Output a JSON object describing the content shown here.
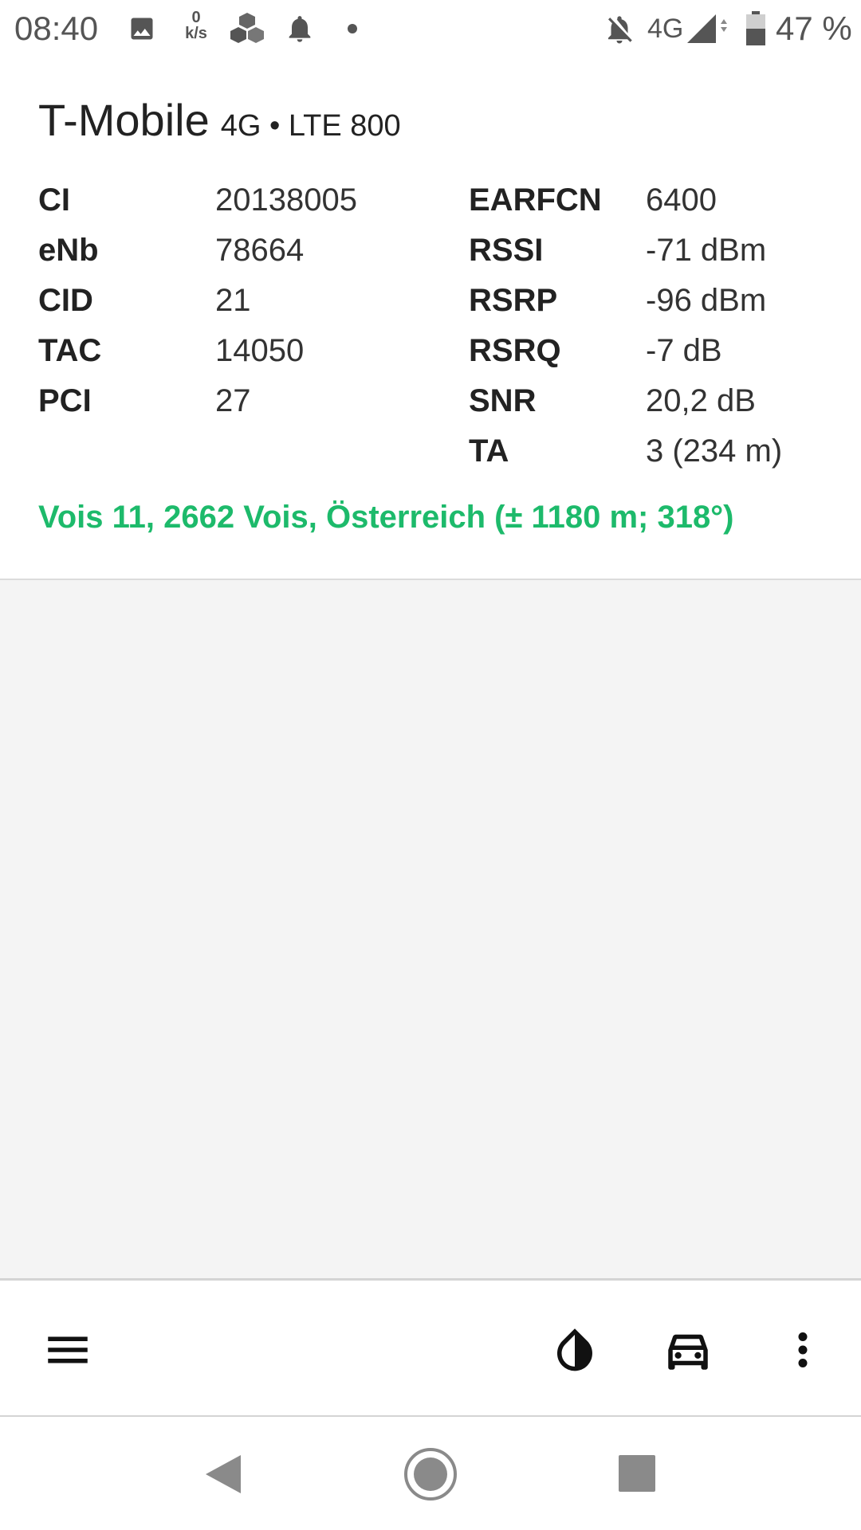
{
  "status_bar": {
    "time": "08:40",
    "net_speed_value": "0",
    "net_speed_unit": "k/s",
    "network_type": "4G",
    "battery": "47 %",
    "icons": [
      "image-icon",
      "net-speed-indicator",
      "cube-app-icon",
      "notification-bell-icon",
      "dot-icon",
      "alarm-off-icon",
      "signal-icon",
      "battery-icon"
    ]
  },
  "cell": {
    "operator": "T-Mobile",
    "technology": "4G • LTE 800",
    "left_fields": [
      {
        "label": "CI",
        "value": "20138005"
      },
      {
        "label": "eNb",
        "value": "78664"
      },
      {
        "label": "CID",
        "value": "21"
      },
      {
        "label": "TAC",
        "value": "14050"
      },
      {
        "label": "PCI",
        "value": "27"
      }
    ],
    "right_fields": [
      {
        "label": "EARFCN",
        "value": "6400"
      },
      {
        "label": "RSSI",
        "value": "-71 dBm"
      },
      {
        "label": "RSRP",
        "value": "-96 dBm"
      },
      {
        "label": "RSRQ",
        "value": "-7 dB"
      },
      {
        "label": "SNR",
        "value": "20,2 dB"
      },
      {
        "label": "TA",
        "value": "3 (234 m)"
      }
    ],
    "location": "Vois 11, 2662 Vois, Österreich (± 1180 m; 318°)"
  },
  "app_bar": {
    "icons": [
      "menu-icon",
      "contrast-icon",
      "car-icon",
      "more-vert-icon"
    ]
  },
  "nav_bar": {
    "icons": [
      "back-icon",
      "home-icon",
      "recents-icon"
    ]
  },
  "colors": {
    "accent_green": "#1dba6b",
    "text_dark": "#222222",
    "status_gray": "#555555",
    "map_bg": "#f4f4f4"
  }
}
